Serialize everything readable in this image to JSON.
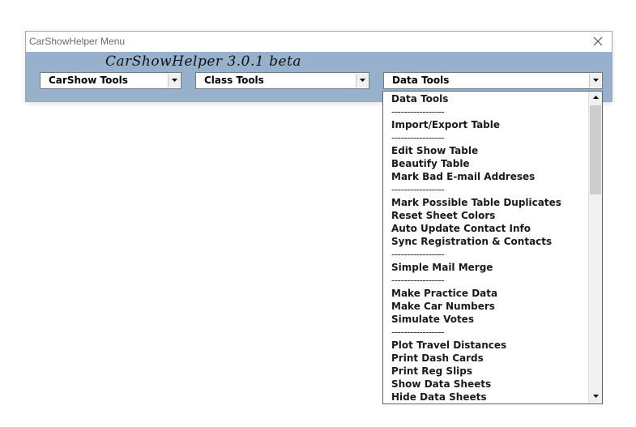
{
  "window": {
    "title": "CarShowHelper Menu",
    "banner": "CarShowHelper 3.0.1 beta"
  },
  "combos": [
    {
      "label": "CarShow Tools"
    },
    {
      "label": "Class Tools"
    },
    {
      "label": "Data Tools"
    }
  ],
  "dropdown": {
    "items": [
      "Data Tools",
      "-----------------",
      "Import/Export Table",
      "-----------------",
      "Edit Show Table",
      "Beautify Table",
      "Mark Bad E-mail Addreses",
      "-----------------",
      "Mark Possible Table Duplicates",
      "Reset Sheet Colors",
      "Auto Update Contact Info",
      "Sync Registration & Contacts",
      "-----------------",
      "Simple Mail Merge",
      "-----------------",
      "Make Practice Data",
      "Make Car Numbers",
      "Simulate Votes",
      "-----------------",
      "Plot Travel Distances",
      "Print Dash Cards",
      "Print Reg Slips",
      "Show Data Sheets",
      "Hide Data Sheets"
    ]
  },
  "icons": {
    "close": "close-icon",
    "dropdown_arrow": "chevron-down-icon",
    "scroll_up": "scroll-up-arrow-icon",
    "scroll_down": "scroll-down-arrow-icon"
  },
  "colors": {
    "panel_background": "#97b0cc",
    "title_text": "#6b6b6b"
  }
}
